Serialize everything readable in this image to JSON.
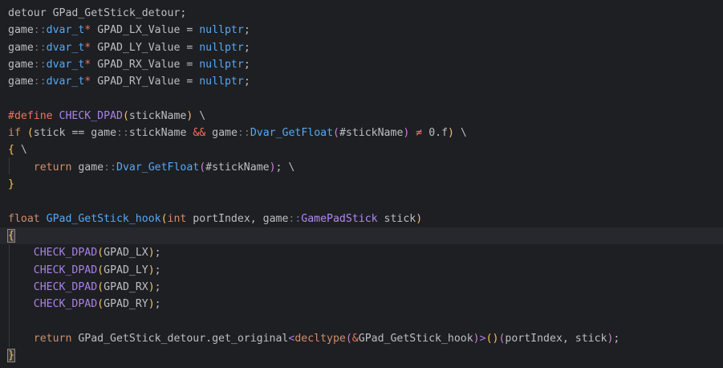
{
  "editor": {
    "language": "C++",
    "current_line_index": 13,
    "lines": [
      [
        {
          "t": "detour GPad_GetStick_detour;",
          "c": "plain"
        }
      ],
      [
        {
          "t": "game",
          "c": "ns"
        },
        {
          "t": "::",
          "c": "scope"
        },
        {
          "t": "dvar_t",
          "c": "type"
        },
        {
          "t": "*",
          "c": "ptr"
        },
        {
          "t": " GPAD_LX_Value = ",
          "c": "plain"
        },
        {
          "t": "nullptr",
          "c": "type"
        },
        {
          "t": ";",
          "c": "plain"
        }
      ],
      [
        {
          "t": "game",
          "c": "ns"
        },
        {
          "t": "::",
          "c": "scope"
        },
        {
          "t": "dvar_t",
          "c": "type"
        },
        {
          "t": "*",
          "c": "ptr"
        },
        {
          "t": " GPAD_LY_Value = ",
          "c": "plain"
        },
        {
          "t": "nullptr",
          "c": "type"
        },
        {
          "t": ";",
          "c": "plain"
        }
      ],
      [
        {
          "t": "game",
          "c": "ns"
        },
        {
          "t": "::",
          "c": "scope"
        },
        {
          "t": "dvar_t",
          "c": "type"
        },
        {
          "t": "*",
          "c": "ptr"
        },
        {
          "t": " GPAD_RX_Value = ",
          "c": "plain"
        },
        {
          "t": "nullptr",
          "c": "type"
        },
        {
          "t": ";",
          "c": "plain"
        }
      ],
      [
        {
          "t": "game",
          "c": "ns"
        },
        {
          "t": "::",
          "c": "scope"
        },
        {
          "t": "dvar_t",
          "c": "type"
        },
        {
          "t": "*",
          "c": "ptr"
        },
        {
          "t": " GPAD_RY_Value = ",
          "c": "plain"
        },
        {
          "t": "nullptr",
          "c": "type"
        },
        {
          "t": ";",
          "c": "plain"
        }
      ],
      [],
      [
        {
          "t": "#define",
          "c": "define"
        },
        {
          "t": " ",
          "c": "plain"
        },
        {
          "t": "CHECK_DPAD",
          "c": "macro"
        },
        {
          "t": "(",
          "c": "paren-y"
        },
        {
          "t": "stickName",
          "c": "param"
        },
        {
          "t": ")",
          "c": "paren-y"
        },
        {
          "t": " \\",
          "c": "plain"
        }
      ],
      [
        {
          "t": "if",
          "c": "keyword"
        },
        {
          "t": " ",
          "c": "plain"
        },
        {
          "t": "(",
          "c": "paren-y"
        },
        {
          "t": "stick ",
          "c": "plain"
        },
        {
          "t": "==",
          "c": "op"
        },
        {
          "t": " game",
          "c": "plain"
        },
        {
          "t": "::",
          "c": "scope"
        },
        {
          "t": "stickName ",
          "c": "plain"
        },
        {
          "t": "&&",
          "c": "operator-kw"
        },
        {
          "t": " game",
          "c": "plain"
        },
        {
          "t": "::",
          "c": "scope"
        },
        {
          "t": "Dvar_GetFloat",
          "c": "func"
        },
        {
          "t": "(",
          "c": "paren-p"
        },
        {
          "t": "#stickName",
          "c": "plain"
        },
        {
          "t": ")",
          "c": "paren-p"
        },
        {
          "t": " ",
          "c": "plain"
        },
        {
          "t": "≠",
          "c": "operator-kw"
        },
        {
          "t": " ",
          "c": "plain"
        },
        {
          "t": "0.f",
          "c": "plain"
        },
        {
          "t": ")",
          "c": "paren-y"
        },
        {
          "t": " \\",
          "c": "plain"
        }
      ],
      [
        {
          "t": "{",
          "c": "brace"
        },
        {
          "t": " \\",
          "c": "plain"
        }
      ],
      [
        {
          "t": "    ",
          "c": "plain"
        },
        {
          "t": "return",
          "c": "keyword"
        },
        {
          "t": " game",
          "c": "plain"
        },
        {
          "t": "::",
          "c": "scope"
        },
        {
          "t": "Dvar_GetFloat",
          "c": "func"
        },
        {
          "t": "(",
          "c": "paren-p"
        },
        {
          "t": "#stickName",
          "c": "plain"
        },
        {
          "t": ")",
          "c": "paren-p"
        },
        {
          "t": "; \\",
          "c": "plain"
        }
      ],
      [
        {
          "t": "}",
          "c": "brace"
        }
      ],
      [],
      [
        {
          "t": "float",
          "c": "keyword"
        },
        {
          "t": " ",
          "c": "plain"
        },
        {
          "t": "GPad_GetStick_hook",
          "c": "method"
        },
        {
          "t": "(",
          "c": "paren-y"
        },
        {
          "t": "int",
          "c": "keyword"
        },
        {
          "t": " portIndex, game",
          "c": "plain"
        },
        {
          "t": "::",
          "c": "scope"
        },
        {
          "t": "GamePadStick",
          "c": "class"
        },
        {
          "t": " stick",
          "c": "plain"
        },
        {
          "t": ")",
          "c": "paren-y"
        }
      ],
      [
        {
          "t": "{",
          "c": "brace-match"
        }
      ],
      [
        {
          "t": "    ",
          "c": "plain"
        },
        {
          "t": "CHECK_DPAD",
          "c": "macro"
        },
        {
          "t": "(",
          "c": "paren-y"
        },
        {
          "t": "GPAD_LX",
          "c": "plain"
        },
        {
          "t": ")",
          "c": "paren-y"
        },
        {
          "t": ";",
          "c": "plain"
        }
      ],
      [
        {
          "t": "    ",
          "c": "plain"
        },
        {
          "t": "CHECK_DPAD",
          "c": "macro"
        },
        {
          "t": "(",
          "c": "paren-y"
        },
        {
          "t": "GPAD_LY",
          "c": "plain"
        },
        {
          "t": ")",
          "c": "paren-y"
        },
        {
          "t": ";",
          "c": "plain"
        }
      ],
      [
        {
          "t": "    ",
          "c": "plain"
        },
        {
          "t": "CHECK_DPAD",
          "c": "macro"
        },
        {
          "t": "(",
          "c": "paren-y"
        },
        {
          "t": "GPAD_RX",
          "c": "plain"
        },
        {
          "t": ")",
          "c": "paren-y"
        },
        {
          "t": ";",
          "c": "plain"
        }
      ],
      [
        {
          "t": "    ",
          "c": "plain"
        },
        {
          "t": "CHECK_DPAD",
          "c": "macro"
        },
        {
          "t": "(",
          "c": "paren-y"
        },
        {
          "t": "GPAD_RY",
          "c": "plain"
        },
        {
          "t": ")",
          "c": "paren-y"
        },
        {
          "t": ";",
          "c": "plain"
        }
      ],
      [],
      [
        {
          "t": "    ",
          "c": "plain"
        },
        {
          "t": "return",
          "c": "keyword"
        },
        {
          "t": " GPad_GetStick_detour.get_original",
          "c": "plain"
        },
        {
          "t": "<",
          "c": "template"
        },
        {
          "t": "decltype",
          "c": "decltype"
        },
        {
          "t": "(",
          "c": "paren-p"
        },
        {
          "t": "&",
          "c": "operator-kw"
        },
        {
          "t": "GPad_GetStick_hook",
          "c": "plain"
        },
        {
          "t": ")",
          "c": "paren-p"
        },
        {
          "t": ">",
          "c": "template"
        },
        {
          "t": "()",
          "c": "paren-y"
        },
        {
          "t": "(",
          "c": "paren-p"
        },
        {
          "t": "portIndex, stick",
          "c": "plain"
        },
        {
          "t": ")",
          "c": "paren-p"
        },
        {
          "t": ";",
          "c": "plain"
        }
      ],
      [
        {
          "t": "}",
          "c": "brace-match"
        }
      ]
    ]
  }
}
